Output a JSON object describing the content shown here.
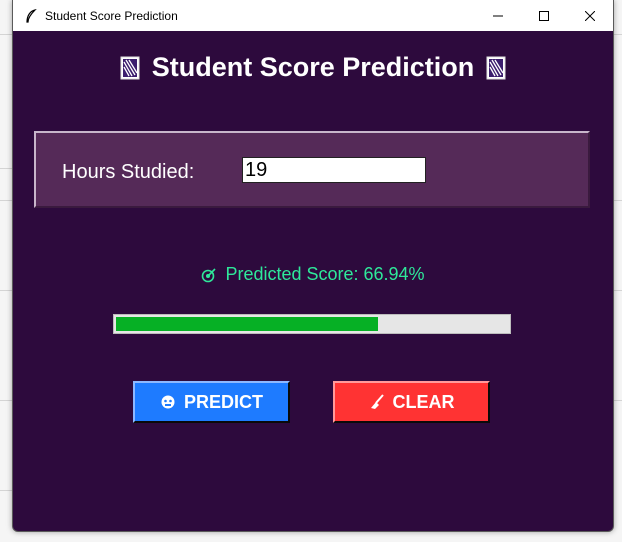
{
  "window": {
    "title": "Student Score Prediction",
    "controls": [
      "minimize-icon",
      "maximize-icon",
      "close-icon"
    ]
  },
  "header": {
    "title": "Student Score Prediction",
    "decoration_icon": "book-icon"
  },
  "input": {
    "label": "Hours Studied:",
    "value": "19"
  },
  "result": {
    "icon": "target-icon",
    "text": "Predicted Score: 66.94%",
    "progress_percent": 66.94
  },
  "buttons": {
    "predict": {
      "label": "PREDICT",
      "icon": "robot-icon",
      "color": "#1e7bff"
    },
    "clear": {
      "label": "CLEAR",
      "icon": "broom-icon",
      "color": "#ff3333"
    }
  },
  "colors": {
    "window_bg": "#2d0a3d",
    "panel_bg": "#552a58",
    "score_text": "#2ee89a",
    "progress_fill": "#06b025"
  }
}
